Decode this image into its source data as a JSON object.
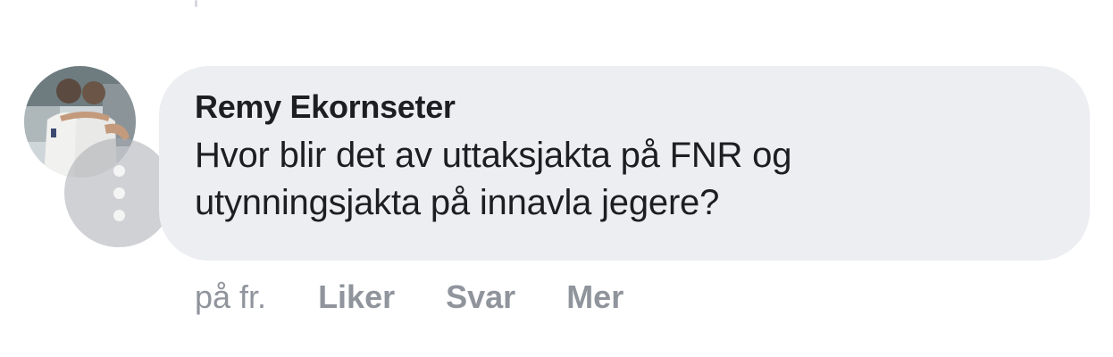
{
  "comment": {
    "author": "Remy Ekornseter",
    "text": "Hvor blir det av uttaksjakta på FNR og\nutynningsjakta på innavla jegere?"
  },
  "actions": {
    "time": "på fr.",
    "like_label": "Liker",
    "reply_label": "Svar",
    "more_label": "Mer"
  },
  "colors": {
    "bubble_bg": "#eceef1",
    "text": "#1c1e21",
    "muted": "#90949c"
  },
  "icons": {
    "overflow": "more-vertical-icon"
  }
}
